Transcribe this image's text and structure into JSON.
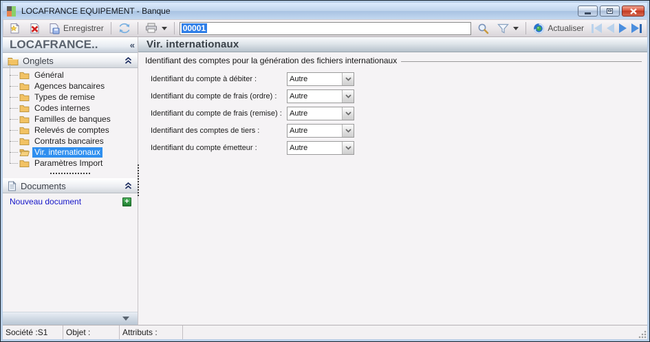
{
  "window": {
    "title": "LOCAFRANCE EQUIPEMENT -  Banque"
  },
  "toolbar": {
    "save_label": "Enregistrer",
    "record_value": "00001",
    "actualiser_label": "Actualiser"
  },
  "sidebar": {
    "title": "LOCAFRANCE..",
    "collapse_glyph": "«",
    "panels": {
      "onglets": "Onglets",
      "documents": "Documents"
    },
    "items": [
      {
        "label": "Général",
        "selected": false
      },
      {
        "label": "Agences bancaires",
        "selected": false
      },
      {
        "label": "Types de remise",
        "selected": false
      },
      {
        "label": "Codes internes",
        "selected": false
      },
      {
        "label": "Familles de banques",
        "selected": false
      },
      {
        "label": "Relevés de comptes",
        "selected": false
      },
      {
        "label": "Contrats bancaires",
        "selected": false
      },
      {
        "label": "Vir. internationaux",
        "selected": true
      },
      {
        "label": "Paramètres Import",
        "selected": false
      }
    ],
    "new_doc_label": "Nouveau document",
    "plus_glyph": "+"
  },
  "main": {
    "title": "Vir. internationaux",
    "legend": "Identifiant des comptes pour la génération des fichiers internationaux",
    "rows": [
      {
        "label": "Identifiant du compte à débiter :",
        "value": "Autre"
      },
      {
        "label": "Identifiant du compte de frais (ordre) :",
        "value": "Autre"
      },
      {
        "label": "Identifiant du compte de frais (remise) :",
        "value": "Autre"
      },
      {
        "label": "Identifiant des comptes de tiers :",
        "value": "Autre"
      },
      {
        "label": "Identifiant du compte émetteur :",
        "value": "Autre"
      }
    ]
  },
  "statusbar": {
    "cells": [
      "Société :S1",
      "Objet :",
      "Attributs :"
    ]
  },
  "icons": {
    "selection_blue": "#2f8fef",
    "folder_gold": "#f2c264",
    "titlebar_blue": "#bfd4ec",
    "close_red": "#c13a22",
    "nav_enabled_blue": "#4b8ede",
    "nav_disabled_blue": "#b9d2ec",
    "link_blue": "#1414c8"
  }
}
